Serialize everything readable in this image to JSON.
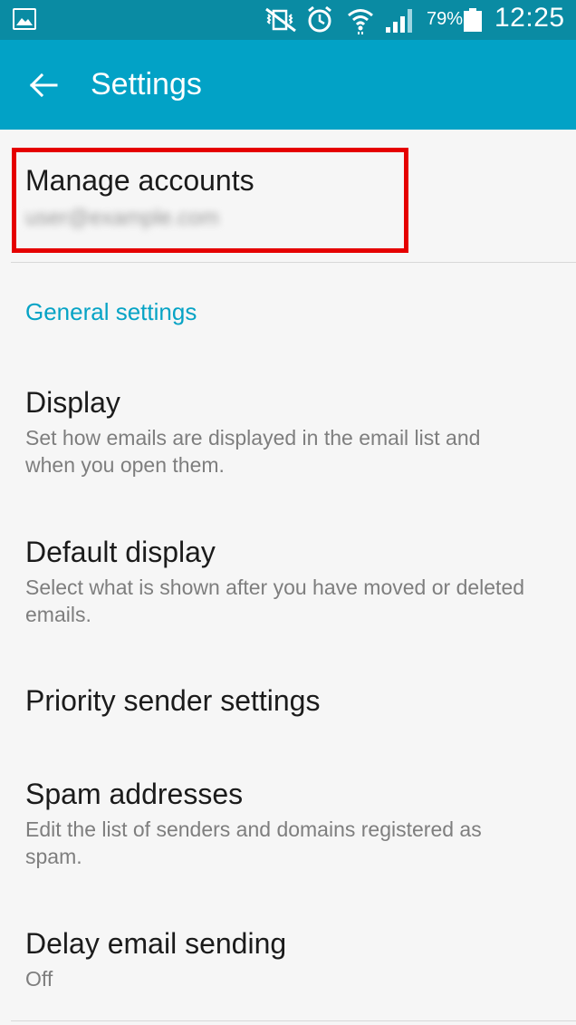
{
  "status_bar": {
    "battery_percent": "79%",
    "time": "12:25",
    "icons": [
      "gallery-icon",
      "vibrate-mute-icon",
      "alarm-icon",
      "wifi-icon",
      "signal-icon",
      "battery-icon"
    ]
  },
  "app_bar": {
    "title": "Settings",
    "back_icon": "arrow-left-icon"
  },
  "manage": {
    "title": "Manage accounts",
    "subtitle": "user@example.com"
  },
  "section": {
    "header": "General settings"
  },
  "settings": [
    {
      "title": "Display",
      "desc": "Set how emails are displayed in the email list and when you open them."
    },
    {
      "title": "Default display",
      "desc": "Select what is shown after you have moved or deleted emails."
    },
    {
      "title": "Priority sender settings",
      "desc": ""
    },
    {
      "title": "Spam addresses",
      "desc": "Edit the list of senders and domains registered as spam."
    },
    {
      "title": "Delay email sending",
      "desc": "Off"
    }
  ],
  "colors": {
    "status_bar": "#0a8ba3",
    "app_bar": "#02a2c6",
    "accent": "#06a3c5",
    "highlight": "#e50000"
  }
}
